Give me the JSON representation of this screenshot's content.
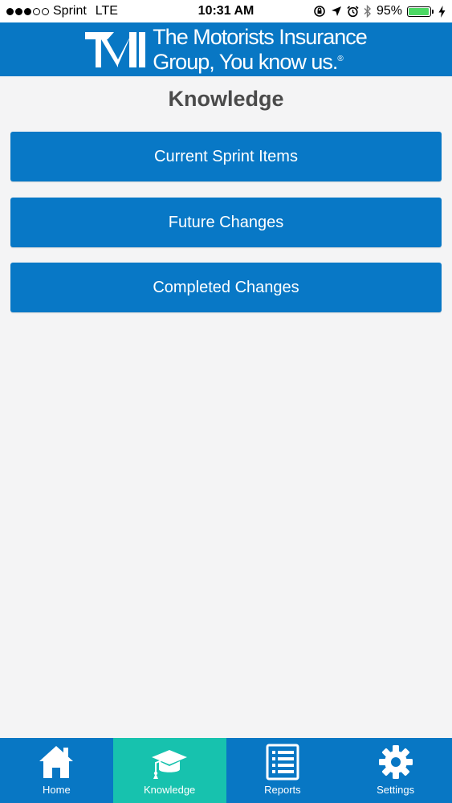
{
  "status_bar": {
    "carrier": "Sprint",
    "network": "LTE",
    "time": "10:31 AM",
    "battery_percent": "95%",
    "battery_level": 0.95,
    "signal_bars_filled": 3,
    "signal_bars_total": 5
  },
  "header": {
    "logo_line1": "The Motorists Insurance",
    "logo_line2": "Group, You know us.",
    "logo_reg": "®"
  },
  "page": {
    "title": "Knowledge"
  },
  "menu": {
    "items": [
      {
        "label": "Current Sprint Items"
      },
      {
        "label": "Future Changes"
      },
      {
        "label": "Completed Changes"
      }
    ]
  },
  "tabs": [
    {
      "label": "Home",
      "icon": "home-icon",
      "active": false
    },
    {
      "label": "Knowledge",
      "icon": "graduation-cap-icon",
      "active": true
    },
    {
      "label": "Reports",
      "icon": "list-icon",
      "active": false
    },
    {
      "label": "Settings",
      "icon": "gear-icon",
      "active": false
    }
  ],
  "colors": {
    "brand_blue": "#0877c4",
    "active_tab": "#17c2ae",
    "battery_green": "#4cd964",
    "title_gray": "#4a4a4a"
  }
}
